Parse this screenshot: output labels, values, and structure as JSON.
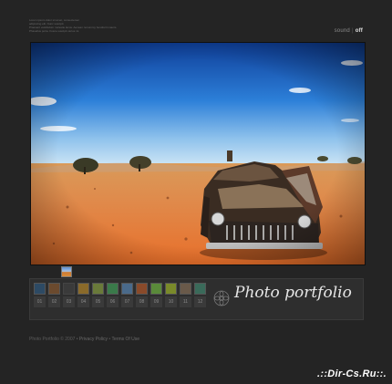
{
  "header": {
    "lines": [
      "Lorem ipsum dolor sit amet, consectetuer",
      "adipiscing elit. Nunc suscipit.",
      "Praesent vestibulum molestie lacus. Aenean nonummy hendrerit mauris.",
      "Phasellus porta. Fusce suscipit varius mi."
    ]
  },
  "sound": {
    "label": "sound",
    "separator": "|",
    "state": "off"
  },
  "thumbs": [
    {
      "num": "01",
      "color": "#3a5a7a"
    },
    {
      "num": "02",
      "color": "#7a5a3a"
    },
    {
      "num": "03",
      "color": ""
    },
    {
      "num": "04",
      "color": "#8a6a2a"
    },
    {
      "num": "05",
      "color": "#6a7a3a"
    },
    {
      "num": "06",
      "color": "#3a7a4a"
    },
    {
      "num": "07",
      "color": "#4a6a8a"
    },
    {
      "num": "08",
      "color": "#8a4a2a"
    },
    {
      "num": "09",
      "color": "#5a8a3a"
    },
    {
      "num": "10",
      "color": "#7a8a2a"
    },
    {
      "num": "11",
      "color": "#6a5a4a"
    },
    {
      "num": "12",
      "color": "#3a6a5a"
    }
  ],
  "portfolio_title": "Photo portfolio",
  "footer": {
    "copyright": "Photo Portfolio © 2007",
    "sep": " • ",
    "privacy": "Privacy Policy",
    "terms": "Terms Of Use"
  },
  "watermark": ".::Dir-Cs.Ru::."
}
